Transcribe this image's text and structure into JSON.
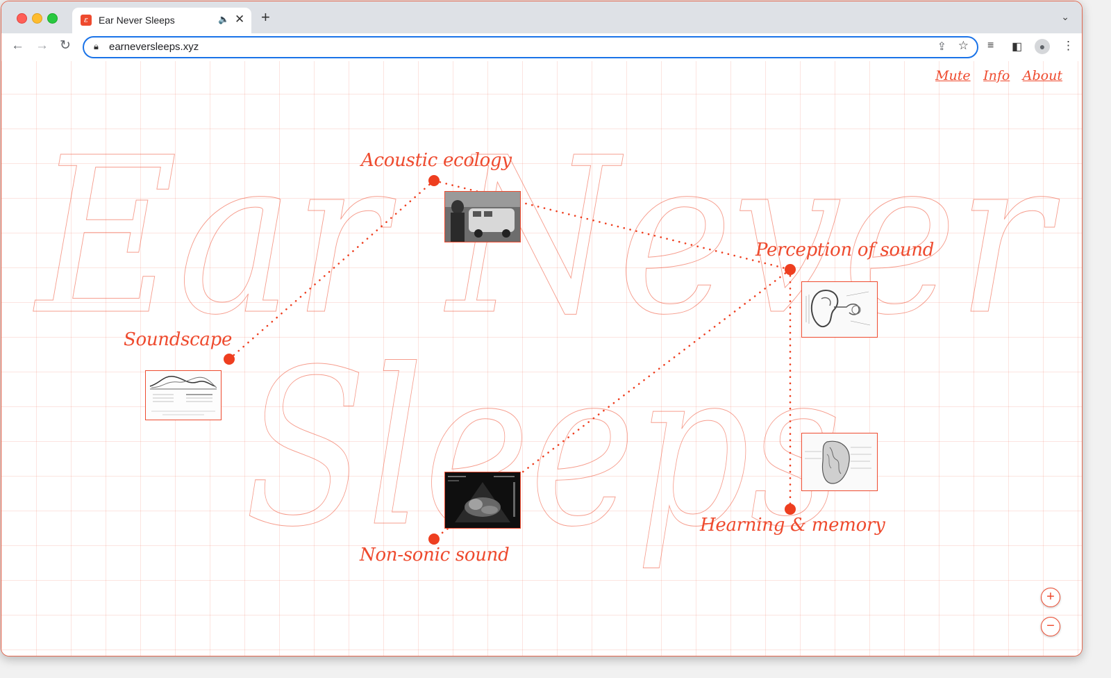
{
  "browser": {
    "tab_title": "Ear Never Sleeps",
    "favicon_icon": "ear-favicon-icon",
    "url": "earneversleeps.xyz",
    "new_tab_label": "+"
  },
  "nav": {
    "items": [
      "Mute",
      "Info",
      "About"
    ]
  },
  "background_title": [
    "Ear Never",
    "Sleeps"
  ],
  "nodes": [
    {
      "label": "Acoustic ecology",
      "image": "photo of a person with microphone next to a van"
    },
    {
      "label": "Perception of sound",
      "image": "anatomical drawing of the human ear"
    },
    {
      "label": "Soundscape",
      "image": "line chart diagram of soundscape levels"
    },
    {
      "label": "Non-sonic sound",
      "image": "ultrasound scan image"
    },
    {
      "label": "Hearning & memory",
      "image": "anatomical drawing of the brain"
    }
  ],
  "zoom": {
    "in_label": "+",
    "out_label": "−"
  },
  "colors": {
    "accent": "#ee4a2e",
    "grid": "#f6c9bf",
    "address_border": "#1a73e8"
  }
}
